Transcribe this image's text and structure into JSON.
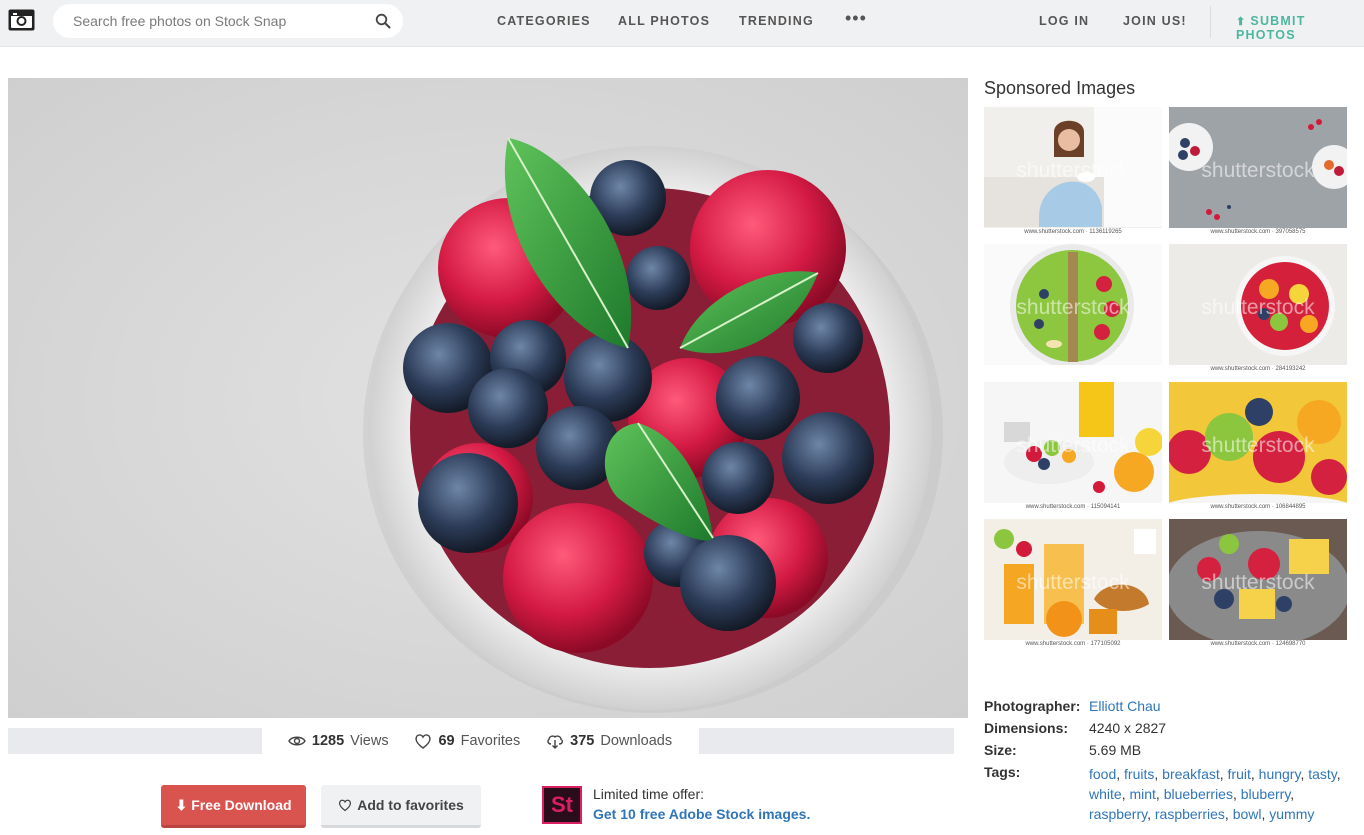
{
  "header": {
    "search_placeholder": "Search free photos on Stock Snap",
    "nav": [
      "CATEGORIES",
      "ALL PHOTOS",
      "TRENDING"
    ],
    "more": "•••",
    "login": "LOG IN",
    "join": "JOIN US!",
    "submit": "SUBMIT PHOTOS",
    "accent_color": "#4db6a0"
  },
  "stats": {
    "views_count": "1285",
    "views_label": "Views",
    "favorites_count": "69",
    "favorites_label": "Favorites",
    "downloads_count": "375",
    "downloads_label": "Downloads"
  },
  "actions": {
    "download_label": "Free Download",
    "favorite_label": "Add to favorites",
    "download_color": "#d9534f"
  },
  "offer": {
    "logo_text": "St",
    "line1": "Limited time offer:",
    "line2": "Get 10 free Adobe Stock images."
  },
  "sidebar": {
    "title": "Sponsored Images",
    "watermark": "shutterstock",
    "thumbs": [
      {
        "caption": "www.shutterstock.com · 1136119265"
      },
      {
        "caption": "www.shutterstock.com · 397058575"
      },
      {
        "caption": ""
      },
      {
        "caption": "www.shutterstock.com · 284193242"
      },
      {
        "caption": "www.shutterstock.com · 115094141"
      },
      {
        "caption": "www.shutterstock.com · 106844895"
      },
      {
        "caption": "www.shutterstock.com · 177105092"
      },
      {
        "caption": "www.shutterstock.com · 124698770"
      }
    ]
  },
  "meta": {
    "photographer_label": "Photographer:",
    "photographer": "Elliott Chau",
    "dimensions_label": "Dimensions:",
    "dimensions": "4240 x 2827",
    "size_label": "Size:",
    "size": "5.69 MB",
    "tags_label": "Tags:",
    "tags": [
      "food",
      "fruits",
      "breakfast",
      "fruit",
      "hungry",
      "tasty",
      "white",
      "mint",
      "blueberries",
      "bluberry",
      "raspberry",
      "raspberries",
      "bowl",
      "yummy"
    ]
  }
}
